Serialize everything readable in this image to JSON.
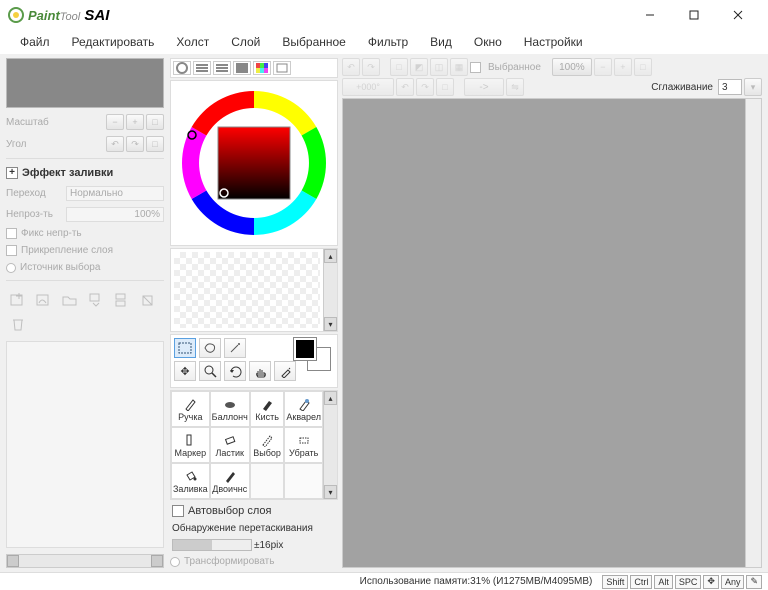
{
  "app": {
    "title_paint": "Paint",
    "title_tool": "Tool",
    "title_sai": " SAI"
  },
  "window": {
    "min": "—",
    "max": "□",
    "close": "✕"
  },
  "menu": [
    "Файл",
    "Редактировать",
    "Холст",
    "Слой",
    "Выбранное",
    "Фильтр",
    "Вид",
    "Окно",
    "Настройки"
  ],
  "nav": {
    "scale_label": "Масштаб",
    "angle_label": "Угол"
  },
  "fill": {
    "title": "Эффект заливки",
    "mode_label": "Переход",
    "mode_value": "Нормально",
    "opacity_label": "Непроз-ть",
    "opacity_value": "100%",
    "fix_opacity": "Фикс непр-ть",
    "clip_layer": "Прикрепление слоя",
    "sel_source": "Источник выбора"
  },
  "brushes": [
    "Ручка",
    "Баллонч",
    "Кисть",
    "Акварел",
    "Маркер",
    "Ластик",
    "Выбор",
    "Убрать",
    "Заливка",
    "Двоичнс",
    "",
    ""
  ],
  "autosel": "Автовыбор слоя",
  "drag_detect_label": "Обнаружение перетаскивания",
  "drag_detect_value": "±16pix",
  "transform": "Трансформировать",
  "top": {
    "selected": "Выбранное",
    "zoom": "100%",
    "angle": "+000°",
    "arrow": "->",
    "smoothing": "Сглаживание",
    "smoothing_val": "3"
  },
  "status": {
    "mem": "Использование памяти:31% (И1275MB/M4095MB)",
    "keys": [
      "Shift",
      "Ctrl",
      "Alt",
      "SPC",
      "✥",
      "Any"
    ],
    "pen": "✎"
  }
}
